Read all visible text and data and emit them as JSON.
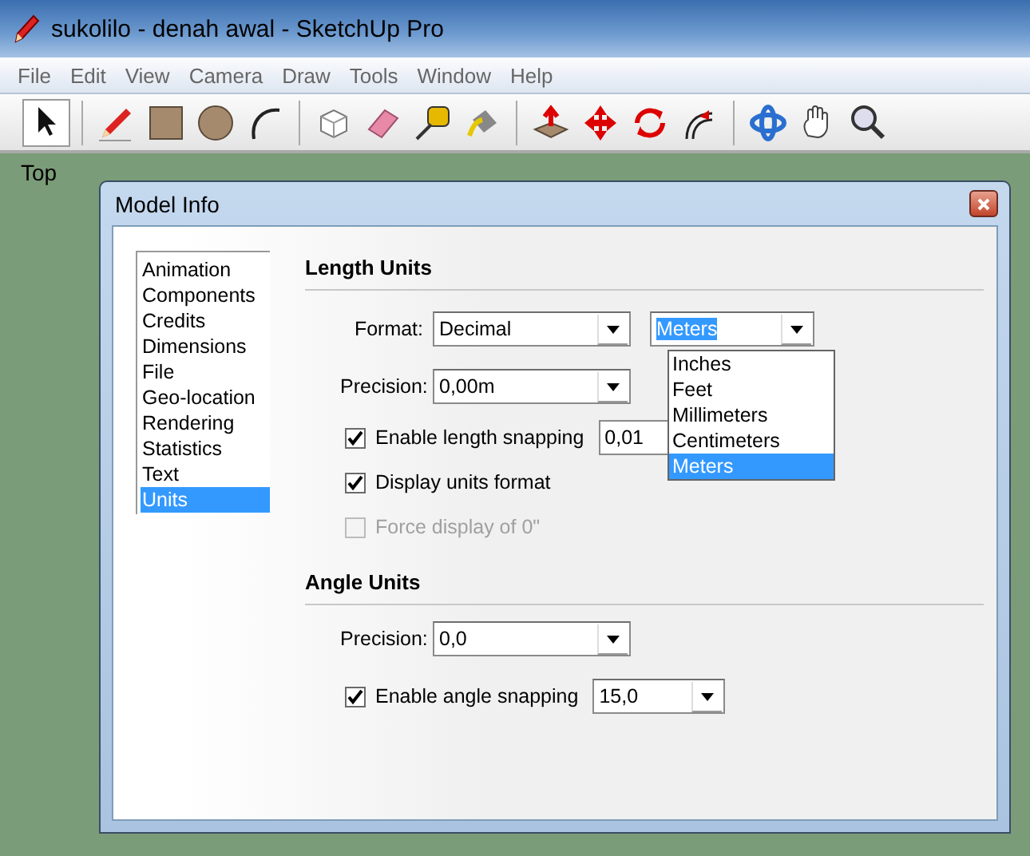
{
  "window": {
    "title": "sukolilo - denah awal - SketchUp Pro"
  },
  "menu": [
    "File",
    "Edit",
    "View",
    "Camera",
    "Draw",
    "Tools",
    "Window",
    "Help"
  ],
  "viewport": {
    "label": "Top"
  },
  "dialog": {
    "title": "Model Info",
    "categories": [
      {
        "label": "Animation",
        "selected": false
      },
      {
        "label": "Components",
        "selected": false
      },
      {
        "label": "Credits",
        "selected": false
      },
      {
        "label": "Dimensions",
        "selected": false
      },
      {
        "label": "File",
        "selected": false
      },
      {
        "label": "Geo-location",
        "selected": false
      },
      {
        "label": "Rendering",
        "selected": false
      },
      {
        "label": "Statistics",
        "selected": false
      },
      {
        "label": "Text",
        "selected": false
      },
      {
        "label": "Units",
        "selected": true
      }
    ],
    "length_units": {
      "heading": "Length Units",
      "format": {
        "label": "Format:",
        "value": "Decimal"
      },
      "unit": {
        "value": "Meters",
        "expanded": true,
        "options": [
          {
            "label": "Inches",
            "selected": false
          },
          {
            "label": "Feet",
            "selected": false
          },
          {
            "label": "Millimeters",
            "selected": false
          },
          {
            "label": "Centimeters",
            "selected": false
          },
          {
            "label": "Meters",
            "selected": true
          }
        ]
      },
      "precision": {
        "label": "Precision:",
        "value": "0,00m"
      },
      "options": [
        {
          "label": "Enable length snapping",
          "checked": true,
          "disabled": false,
          "value": "0,01"
        },
        {
          "label": "Display units format",
          "checked": true,
          "disabled": false
        },
        {
          "label": "Force display of 0\"",
          "checked": false,
          "disabled": true
        }
      ]
    },
    "angle_units": {
      "heading": "Angle Units",
      "precision": {
        "label": "Precision:",
        "value": "0,0"
      },
      "snapping": {
        "label": "Enable angle snapping",
        "checked": true,
        "disabled": false,
        "value": "15,0"
      }
    }
  }
}
